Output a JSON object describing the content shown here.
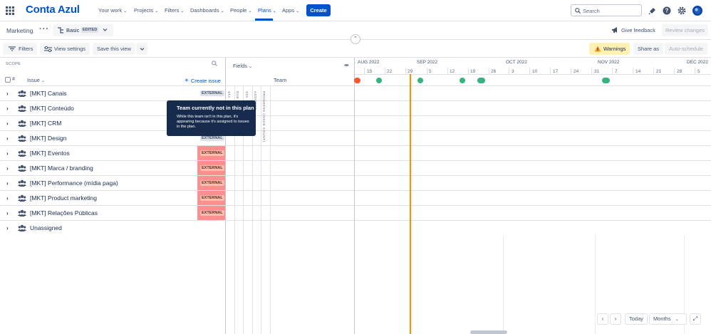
{
  "nav": {
    "logo": "Conta Azul",
    "items": [
      {
        "label": "Your work",
        "chevron": "⌄"
      },
      {
        "label": "Projects",
        "chevron": "⌄"
      },
      {
        "label": "Filters",
        "chevron": "⌄"
      },
      {
        "label": "Dashboards",
        "chevron": "⌄"
      },
      {
        "label": "People",
        "chevron": "⌄"
      },
      {
        "label": "Plans",
        "chevron": "⌄"
      },
      {
        "label": "Apps",
        "chevron": "⌄"
      }
    ],
    "create": "Create",
    "search_placeholder": "Search"
  },
  "plan_bar": {
    "title": "Marketing",
    "scenario": "Basic",
    "scenario_badge": "EDITED",
    "give_feedback": "Give feedback",
    "review_changes": "Review changes"
  },
  "toolbar": {
    "filters": "Filters",
    "view_settings": "View settings",
    "save_view": "Save this view",
    "warnings": "Warnings",
    "share_as": "Share as",
    "auto_schedule": "Auto-schedule"
  },
  "columns": {
    "scope": "SCOPE",
    "hash": "#",
    "issue": "Issue",
    "create_issue": "Create issue",
    "fields": "Fields",
    "team": "Team",
    "field_labels": [
      "STA",
      "DUE",
      "STA",
      "ASSIGNEE",
      "PROGRESS (ISSUE COUNT)"
    ]
  },
  "rows": [
    {
      "label": "[MKT] Canais",
      "badge": "EXTERNAL",
      "highlight": false
    },
    {
      "label": "[MKT] Conteúdo",
      "badge": "",
      "highlight": false
    },
    {
      "label": "[MKT] CRM",
      "badge": "",
      "highlight": false
    },
    {
      "label": "[MKT] Design",
      "badge": "EXTERNAL",
      "highlight": false
    },
    {
      "label": "[MKT] Eventos",
      "badge": "EXTERNAL",
      "highlight": true
    },
    {
      "label": "[MKT] Marca / branding",
      "badge": "EXTERNAL",
      "highlight": true
    },
    {
      "label": "[MKT] Performance (mídia paga)",
      "badge": "EXTERNAL",
      "highlight": true
    },
    {
      "label": "[MKT] Product marketing",
      "badge": "EXTERNAL",
      "highlight": true
    },
    {
      "label": "[MKT] Relações Públicas",
      "badge": "EXTERNAL",
      "highlight": true
    },
    {
      "label": "Unassigned",
      "badge": "",
      "highlight": false
    }
  ],
  "tooltip": {
    "title": "Team currently not in this plan",
    "body": "While this team isn't in this plan, it's appearing because it's assigned to issues in the plan."
  },
  "timeline": {
    "months": [
      "AUG 2022",
      "SEP 2022",
      "OCT 2022",
      "NOV 2022",
      "DEC 2022"
    ],
    "days": [
      "15",
      "22",
      "29",
      "5",
      "12",
      "19",
      "26",
      "3",
      "10",
      "17",
      "24",
      "31",
      "7",
      "14",
      "21",
      "28",
      "5"
    ],
    "today_button": "Today",
    "scale": "Months"
  },
  "colors": {
    "brand": "#0052cc",
    "today_line": "#ff8b00",
    "milestone": "#36b37e",
    "external_highlight": "#ff8f8f",
    "warning_bg": "#fff0b3"
  }
}
